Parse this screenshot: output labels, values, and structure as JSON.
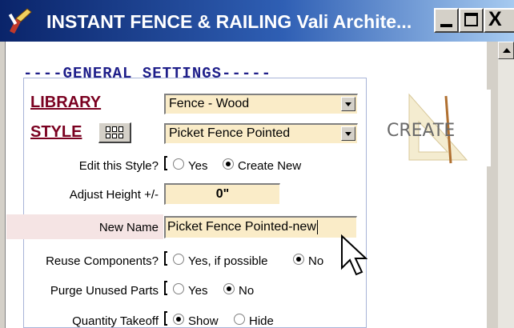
{
  "window": {
    "title": "INSTANT FENCE & RAILING  Vali Archite...",
    "buttons": {
      "minimize": "minimize",
      "maximize": "maximize",
      "close": "X"
    }
  },
  "general_settings": {
    "header": "----GENERAL SETTINGS-----",
    "library": {
      "label": "LIBRARY",
      "value": "Fence - Wood"
    },
    "style": {
      "label": "STYLE",
      "value": "Picket Fence Pointed"
    },
    "edit_style": {
      "label": "Edit this Style?",
      "options": [
        "Yes",
        "Create New"
      ],
      "selected": "Create New"
    },
    "adjust_height": {
      "label": "Adjust Height +/-",
      "value": "0\""
    },
    "new_name": {
      "label": "New Name",
      "value": "Picket Fence Pointed-new"
    },
    "reuse_components": {
      "label": "Reuse Components?",
      "options": [
        "Yes, if possible",
        "No"
      ],
      "selected": "No"
    },
    "purge_unused": {
      "label": "Purge Unused Parts",
      "options": [
        "Yes",
        "No"
      ],
      "selected": "No"
    },
    "quantity_takeoff": {
      "label": "Quantity Takeoff",
      "options": [
        "Show",
        "Hide"
      ],
      "selected": "Show"
    }
  },
  "create_logo": {
    "text": "CREATE"
  },
  "icons": [
    "app-icon",
    "style-grid-icon",
    "create-logo-icon",
    "mouse-cursor-icon"
  ],
  "colors": {
    "titlebar_start": "#0a246a",
    "titlebar_end": "#a6caf0",
    "field_bg": "#faecc8",
    "label_accent": "#7a0020",
    "header_text": "#1f1f8a"
  }
}
